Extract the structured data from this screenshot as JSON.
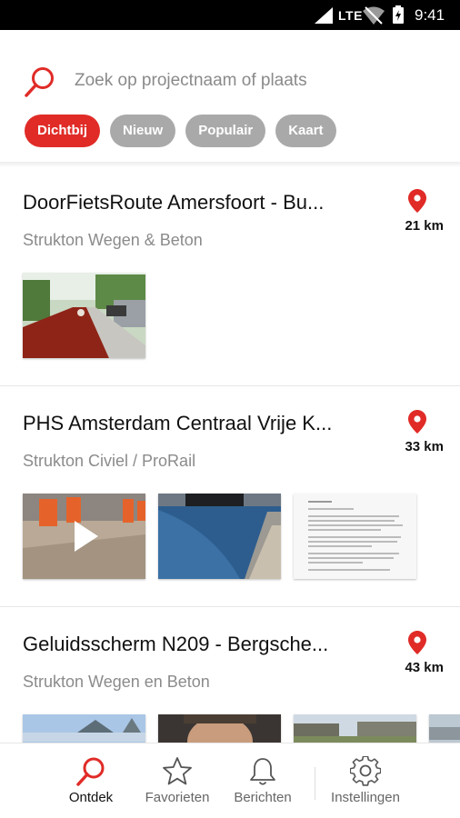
{
  "status_bar": {
    "network": "LTE",
    "time": "9:41"
  },
  "search": {
    "placeholder": "Zoek op projectnaam of plaats",
    "icon": "search-icon"
  },
  "filters": [
    {
      "label": "Dichtbij",
      "active": true
    },
    {
      "label": "Nieuw",
      "active": false
    },
    {
      "label": "Populair",
      "active": false
    },
    {
      "label": "Kaart",
      "active": false
    }
  ],
  "projects": [
    {
      "title": "DoorFietsRoute Amersfoort - Bu...",
      "company": "Strukton Wegen & Beton",
      "distance": "21 km",
      "media": [
        "photo-cycle-path"
      ]
    },
    {
      "title": "PHS Amsterdam Centraal Vrije K...",
      "company": "Strukton Civiel / ProRail",
      "distance": "33 km",
      "media": [
        "video-workers",
        "photo-canal",
        "document-page"
      ]
    },
    {
      "title": "Geluidsscherm N209 - Bergsche...",
      "company": "Strukton Wegen en Beton",
      "distance": "43 km",
      "media": [
        "photo-sky",
        "photo-person",
        "photo-buildings",
        "photo-partial"
      ]
    }
  ],
  "bottom_nav": [
    {
      "label": "Ontdek",
      "icon": "search-icon",
      "active": true
    },
    {
      "label": "Favorieten",
      "icon": "star-icon",
      "active": false
    },
    {
      "label": "Berichten",
      "icon": "bell-icon",
      "active": false
    },
    {
      "label": "Instellingen",
      "icon": "gear-icon",
      "active": false
    }
  ],
  "colors": {
    "accent": "#e02b27",
    "chip_inactive": "#a9a9a9",
    "subtext": "#8b8b8b"
  }
}
